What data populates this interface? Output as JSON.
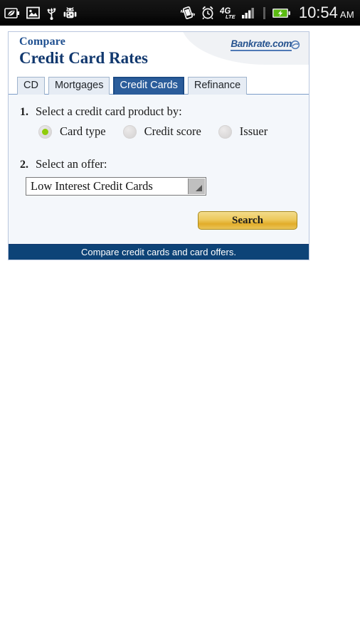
{
  "statusbar": {
    "left_icons": [
      {
        "name": "eco-battery-icon",
        "glyph": "eco-battery"
      },
      {
        "name": "image-icon",
        "glyph": "picture"
      },
      {
        "name": "usb-icon",
        "glyph": "usb"
      },
      {
        "name": "android-debug-icon",
        "glyph": "android"
      }
    ],
    "right_icons": [
      {
        "name": "vibrate-icon",
        "glyph": "vibrate"
      },
      {
        "name": "alarm-clock-icon",
        "glyph": "alarm"
      },
      {
        "name": "network-4g-lte-icon",
        "label_top": "4G",
        "label_bottom": "LTE"
      },
      {
        "name": "signal-bars-icon",
        "bars": 4
      },
      {
        "name": "battery-charging-icon",
        "glyph": "battery-charging"
      }
    ],
    "time": "10:54",
    "ampm": "AM"
  },
  "card": {
    "header": {
      "eyebrow": "Compare",
      "title": "Credit Card Rates",
      "brand": "Bankrate.com"
    },
    "tabs": [
      {
        "label": "CD",
        "active": false
      },
      {
        "label": "Mortgages",
        "active": false
      },
      {
        "label": "Credit Cards",
        "active": true
      },
      {
        "label": "Refinance",
        "active": false
      }
    ],
    "step1": {
      "number": "1.",
      "label": "Select a credit card product by:",
      "options": [
        {
          "label": "Card type",
          "selected": true
        },
        {
          "label": "Credit score",
          "selected": false
        },
        {
          "label": "Issuer",
          "selected": false
        }
      ]
    },
    "step2": {
      "number": "2.",
      "label": "Select an offer:",
      "select_value": "Low Interest Credit Cards"
    },
    "search_button": "Search",
    "footer": "Compare credit cards and card offers."
  },
  "colors": {
    "brand_blue": "#11386e",
    "tab_active": "#2b5d9b",
    "footer_bar": "#0d4377",
    "radio_green": "#8ecc09",
    "search_gold": "#e2ad2a"
  }
}
